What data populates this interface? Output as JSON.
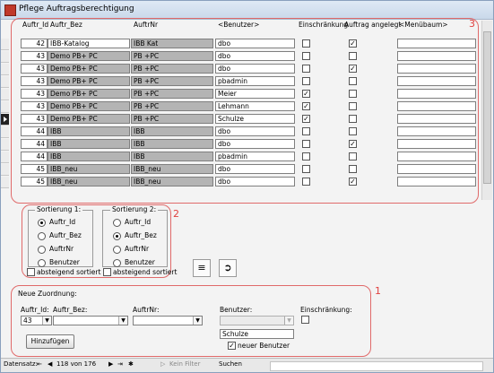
{
  "window": {
    "title": "Pflege Auftragsberechtigung"
  },
  "columns": [
    "Auftr_Id",
    "Auftr_Bez",
    "AuftrNr",
    "<Benutzer>",
    "Einschränkung",
    "Auftrag angelegt",
    "<Menübaum>"
  ],
  "rows": [
    {
      "id": "42",
      "bez": "IBB-Katalog",
      "nr": "IBB Kat",
      "benutzer": "dbo",
      "einschraenkung": false,
      "angelegt": true,
      "menue": "",
      "bez_gray": false
    },
    {
      "id": "43",
      "bez": "Demo PB+ PC",
      "nr": "PB +PC",
      "benutzer": "dbo",
      "einschraenkung": false,
      "angelegt": false,
      "menue": "",
      "bez_gray": true
    },
    {
      "id": "43",
      "bez": "Demo PB+ PC",
      "nr": "PB +PC",
      "benutzer": "dbo",
      "einschraenkung": false,
      "angelegt": true,
      "menue": "",
      "bez_gray": true
    },
    {
      "id": "43",
      "bez": "Demo PB+ PC",
      "nr": "PB +PC",
      "benutzer": "pbadmin",
      "einschraenkung": false,
      "angelegt": false,
      "menue": "",
      "bez_gray": true
    },
    {
      "id": "43",
      "bez": "Demo PB+ PC",
      "nr": "PB +PC",
      "benutzer": "Meier",
      "einschraenkung": true,
      "angelegt": false,
      "menue": "",
      "bez_gray": true
    },
    {
      "id": "43",
      "bez": "Demo PB+ PC",
      "nr": "PB +PC",
      "benutzer": "Lehmann",
      "einschraenkung": true,
      "angelegt": false,
      "menue": "",
      "bez_gray": true
    },
    {
      "id": "43",
      "bez": "Demo PB+ PC",
      "nr": "PB +PC",
      "benutzer": "Schulze",
      "einschraenkung": true,
      "angelegt": false,
      "menue": "",
      "bez_gray": true
    },
    {
      "id": "44",
      "bez": "IBB",
      "nr": "IBB",
      "benutzer": "dbo",
      "einschraenkung": false,
      "angelegt": false,
      "menue": "",
      "bez_gray": true
    },
    {
      "id": "44",
      "bez": "IBB",
      "nr": "IBB",
      "benutzer": "dbo",
      "einschraenkung": false,
      "angelegt": true,
      "menue": "",
      "bez_gray": true
    },
    {
      "id": "44",
      "bez": "IBB",
      "nr": "IBB",
      "benutzer": "pbadmin",
      "einschraenkung": false,
      "angelegt": false,
      "menue": "",
      "bez_gray": true
    },
    {
      "id": "45",
      "bez": "IBB_neu",
      "nr": "IBB_neu",
      "benutzer": "dbo",
      "einschraenkung": false,
      "angelegt": false,
      "menue": "",
      "bez_gray": true
    },
    {
      "id": "45",
      "bez": "IBB_neu",
      "nr": "IBB_neu",
      "benutzer": "dbo",
      "einschraenkung": false,
      "angelegt": true,
      "menue": "",
      "bez_gray": true
    }
  ],
  "active_row": 6,
  "annotations": {
    "grid": "3",
    "sort": "2",
    "form": "1"
  },
  "sort1": {
    "title": "Sortierung 1:",
    "options": [
      "Auftr_Id",
      "Auftr_Bez",
      "AuftrNr",
      "Benutzer"
    ],
    "selected": 0,
    "desc_label": "absteigend sortiert",
    "desc_checked": false
  },
  "sort2": {
    "title": "Sortierung 2:",
    "options": [
      "Auftr_Id",
      "Auftr_Bez",
      "AuftrNr",
      "Benutzer"
    ],
    "selected": 1,
    "desc_label": "absteigend sortiert",
    "desc_checked": false
  },
  "form": {
    "title": "Neue Zuordnung:",
    "auftr_id_label": "Auftr_Id:",
    "auftr_id_value": "43",
    "auftr_bez_label": "Auftr_Bez:",
    "auftr_bez_value": "",
    "auftrnr_label": "AuftrNr:",
    "auftrnr_value": "",
    "benutzer_label": "Benutzer:",
    "benutzer_value": "",
    "einschraenkung_label": "Einschränkung:",
    "einschraenkung_checked": false,
    "new_user_value": "Schulze",
    "new_user_label": "neuer Benutzer",
    "new_user_checked": true,
    "add_button": "Hinzufügen"
  },
  "navbar": {
    "label": "Datensatz:",
    "record": "118 von 176",
    "filter": "Kein Filter",
    "search": "Suchen"
  },
  "colors": {
    "accent_red": "#e0413f",
    "disabled_gray": "#b4b4b4"
  }
}
